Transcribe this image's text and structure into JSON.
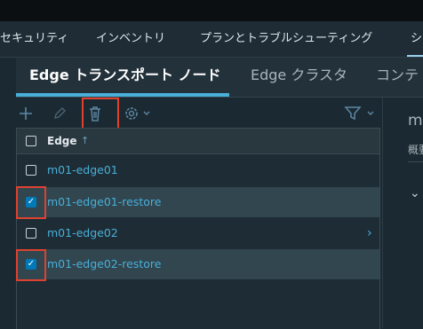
{
  "nav": {
    "items": [
      "セキュリティ",
      "インベントリ",
      "プランとトラブルシューティング",
      "シ"
    ]
  },
  "subtabs": [
    "Edge トランスポート ノード",
    "Edge クラスタ",
    "コンテ"
  ],
  "toolbar": {
    "add_icon": "plus",
    "edit_icon": "pencil",
    "delete_icon": "trash",
    "settings_icon": "gear",
    "filter_icon": "filter"
  },
  "table": {
    "column_header": "Edge",
    "sort_indicator": "↑",
    "rows": [
      {
        "name": "m01-edge01",
        "checked": false
      },
      {
        "name": "m01-edge01-restore",
        "checked": true
      },
      {
        "name": "m01-edge02",
        "checked": false
      },
      {
        "name": "m01-edge02-restore",
        "checked": true
      }
    ]
  },
  "detail": {
    "title": "m0",
    "subtitle": "概要"
  },
  "colors": {
    "accent": "#49afd9",
    "highlight_box": "#e0412f",
    "checkbox_checked": "#0079b8"
  }
}
